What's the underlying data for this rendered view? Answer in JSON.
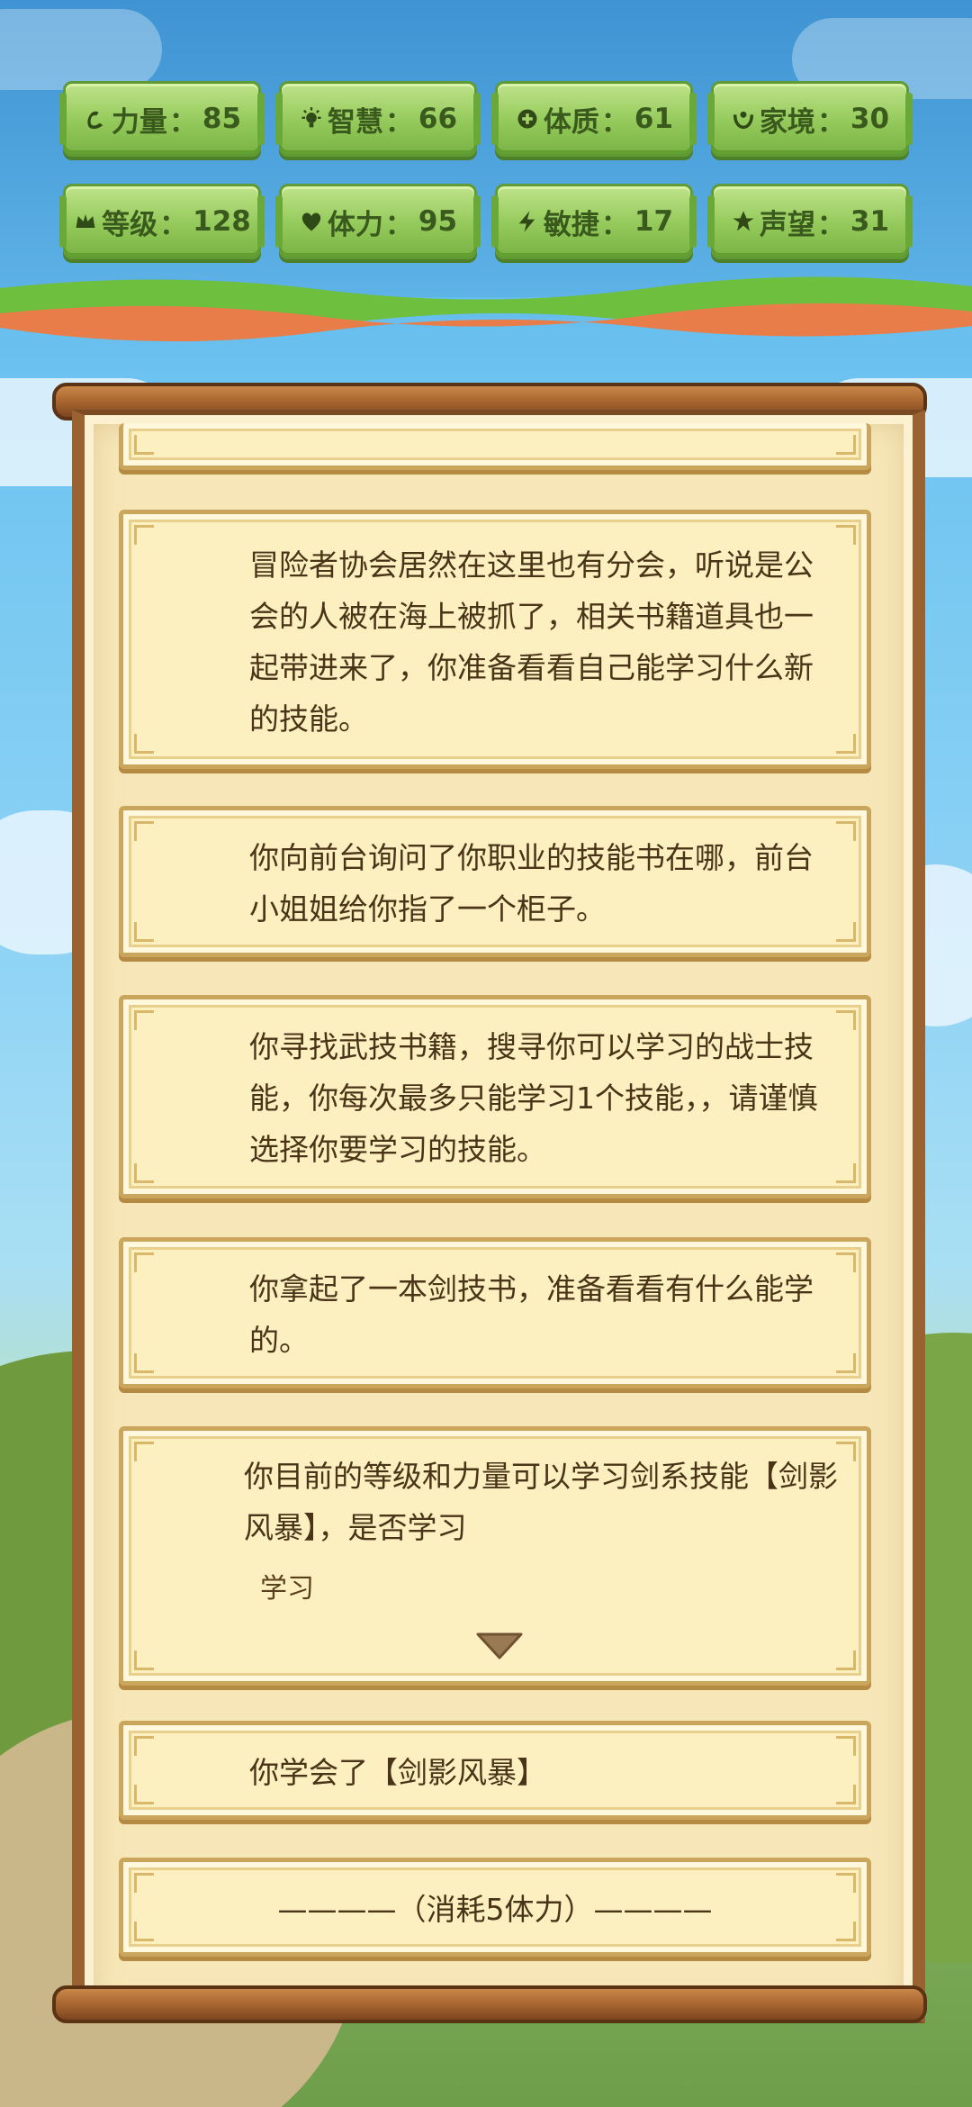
{
  "stats": [
    {
      "icon": "muscle-icon",
      "label": "力量",
      "value": "85"
    },
    {
      "icon": "bulb-icon",
      "label": "智慧",
      "value": "66"
    },
    {
      "icon": "health-icon",
      "label": "体质",
      "value": "61"
    },
    {
      "icon": "family-icon",
      "label": "家境",
      "value": "30"
    },
    {
      "icon": "crown-icon",
      "label": "等级",
      "value": "128"
    },
    {
      "icon": "heart-icon",
      "label": "体力",
      "value": "95"
    },
    {
      "icon": "lightning-icon",
      "label": "敏捷",
      "value": "17"
    },
    {
      "icon": "star-icon",
      "label": "声望",
      "value": "31"
    }
  ],
  "stat_separator": "：",
  "messages": [
    "冒险者协会居然在这里也有分会，听说是公会的人被在海上被抓了，相关书籍道具也一起带进来了，你准备看看自己能学习什么新的技能。",
    "你向前台询问了你职业的技能书在哪，前台小姐姐给你指了一个柜子。",
    "你寻找武技书籍，搜寻你可以学习的战士技能，你每次最多只能学习1个技能，，请谨慎选择你要学习的技能。",
    "你拿起了一本剑技书，准备看看有什么能学的。",
    "你目前的等级和力量可以学习剑系技能【剑影风暴】，是否学习",
    "你学会了【剑影风暴】",
    "————（消耗5体力）————"
  ],
  "choice": {
    "label": "学习"
  },
  "colors": {
    "chip_green": "#93c95a",
    "parchment": "#f7e7b8",
    "card": "#fcefc0",
    "wood": "#a8652f",
    "text": "#4a3418"
  }
}
